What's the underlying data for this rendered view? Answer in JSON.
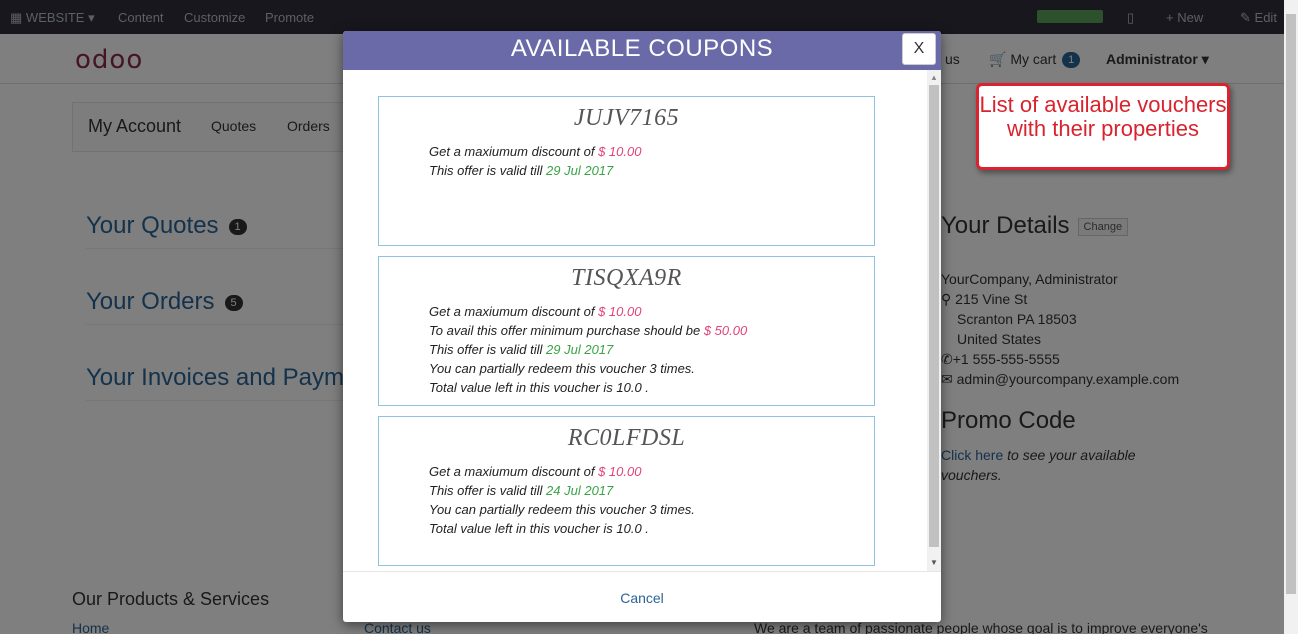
{
  "adminbar": {
    "website_label": "WEBSITE",
    "items": [
      "Content",
      "Customize",
      "Promote"
    ],
    "new_label": "New",
    "edit_label": "Edit"
  },
  "header": {
    "logo": "odoo",
    "contact_fragment": "us",
    "cart_label": "My cart",
    "cart_count": "1",
    "user_label": "Administrator"
  },
  "account_nav": {
    "title": "My Account",
    "links": [
      "Quotes",
      "Orders"
    ]
  },
  "sections": [
    {
      "title": "Your Quotes",
      "count": "1"
    },
    {
      "title": "Your Orders",
      "count": "5"
    },
    {
      "title": "Your Invoices and Paym",
      "count": ""
    }
  ],
  "details": {
    "title": "Your Details",
    "change_label": "Change",
    "lines": [
      "YourCompany, Administrator",
      "215 Vine St",
      "Scranton PA 18503",
      "United States",
      "+1 555-555-5555",
      "admin@yourcompany.example.com"
    ]
  },
  "promo": {
    "title": "Promo Code",
    "link": "Click here",
    "text": " to see your available vouchers."
  },
  "footer": {
    "title": "Our Products & Services",
    "links": [
      "Home",
      "Contact us"
    ],
    "text": "We are a team of passionate people whose goal is to improve everyone's"
  },
  "modal": {
    "title": "AVAILABLE COUPONS",
    "close_label": "X",
    "cancel_label": "Cancel",
    "coupons": [
      {
        "code": "JUJV7165",
        "discount_prefix": "Get a maxiumum discount of ",
        "discount": "$ 10.00",
        "valid_prefix": "This offer is valid till ",
        "valid_date": "29 Jul 2017"
      },
      {
        "code": "TISQXA9R",
        "discount_prefix": "Get a maxiumum discount of ",
        "discount": "$ 10.00",
        "min_prefix": "To avail this offer minimum purchase should be ",
        "min_amount": "$ 50.00",
        "valid_prefix": "This offer is valid till ",
        "valid_date": "29 Jul 2017",
        "partial": "You can partially redeem this voucher 3 times.",
        "total": "Total value left in this voucher is 10.0 ."
      },
      {
        "code": "RC0LFDSL",
        "discount_prefix": "Get a maxiumum discount of ",
        "discount": "$ 10.00",
        "valid_prefix": "This offer is valid till ",
        "valid_date": "24 Jul 2017",
        "partial": "You can partially redeem this voucher 3 times.",
        "total": "Total value left in this voucher is 10.0 ."
      }
    ]
  },
  "callout": {
    "text": "List of available vouchers with their properties"
  },
  "colors": {
    "modal_header": "#6a6aa8",
    "discount": "#e0457b",
    "date": "#3aa346",
    "callout": "#d9232e"
  }
}
